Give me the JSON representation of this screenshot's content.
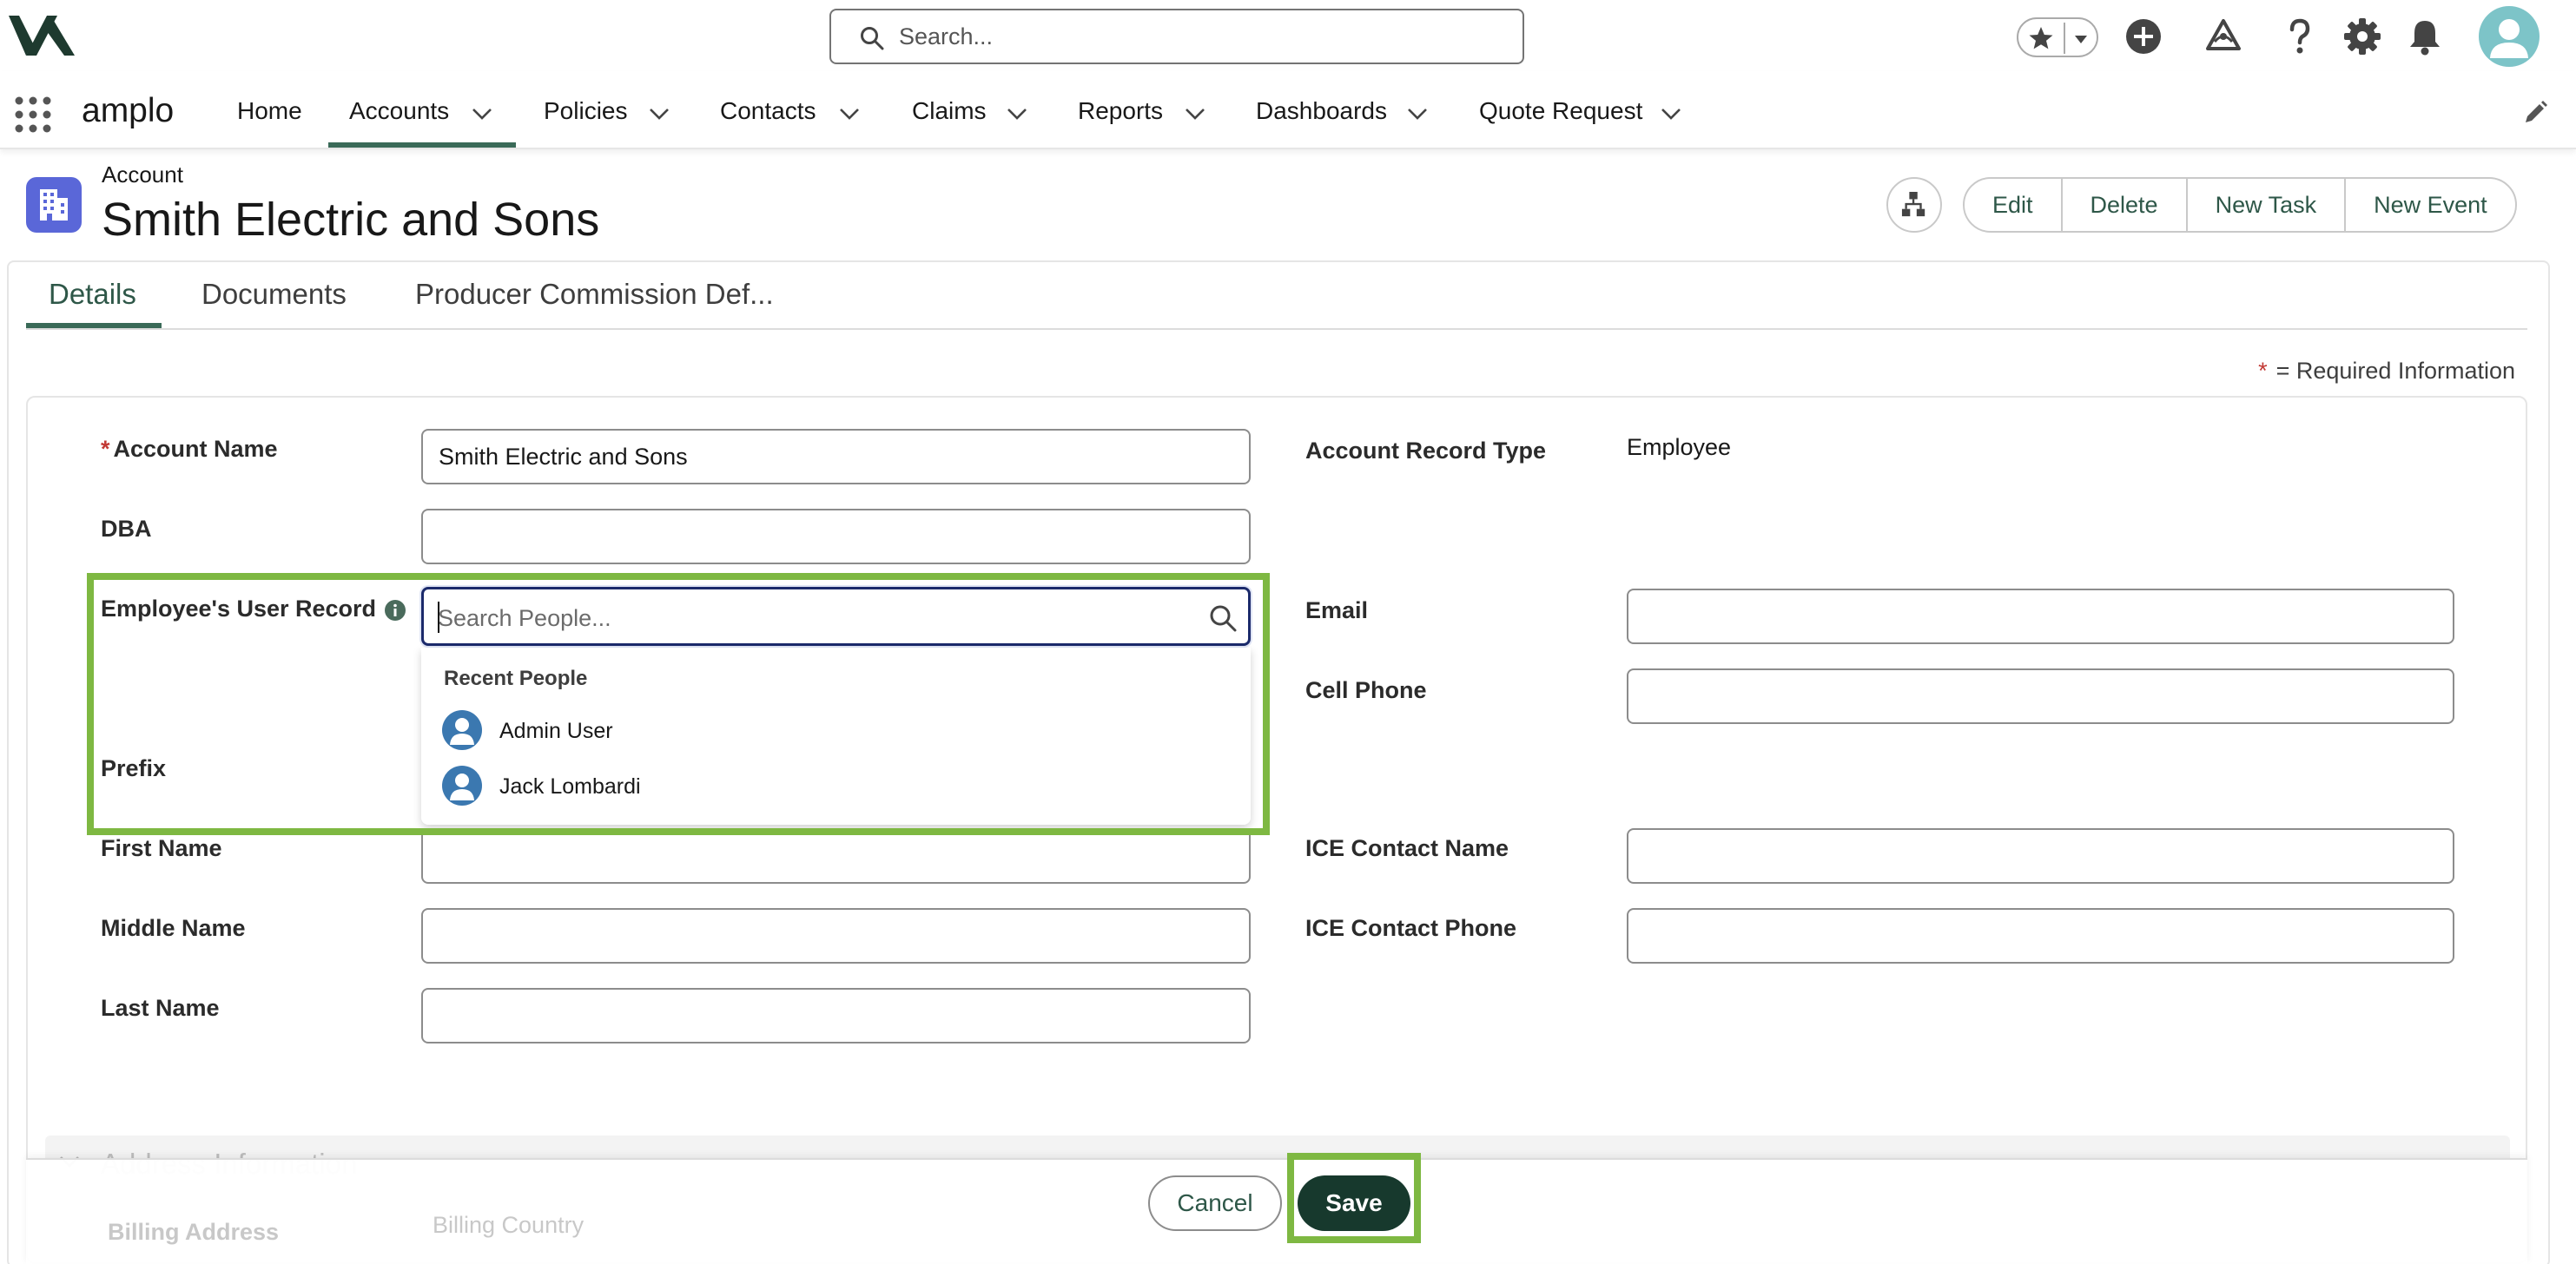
{
  "header": {
    "search_placeholder": "Search...",
    "icons": [
      "favorites-star-icon",
      "favorites-dropdown-icon",
      "global-add-icon",
      "trailhead-icon",
      "help-icon",
      "settings-gear-icon",
      "notifications-bell-icon",
      "user-avatar"
    ]
  },
  "nav": {
    "app_name": "amplo",
    "items": [
      {
        "label": "Home",
        "has_menu": false
      },
      {
        "label": "Accounts",
        "has_menu": true,
        "active": true
      },
      {
        "label": "Policies",
        "has_menu": true
      },
      {
        "label": "Contacts",
        "has_menu": true
      },
      {
        "label": "Claims",
        "has_menu": true
      },
      {
        "label": "Reports",
        "has_menu": true
      },
      {
        "label": "Dashboards",
        "has_menu": true
      },
      {
        "label": "Quote Request",
        "has_menu": true
      }
    ]
  },
  "record": {
    "object_label": "Account",
    "title": "Smith Electric and Sons",
    "actions": [
      "Edit",
      "Delete",
      "New Task",
      "New Event"
    ]
  },
  "tabs": [
    {
      "label": "Details",
      "active": true
    },
    {
      "label": "Documents"
    },
    {
      "label": "Producer Commission Def..."
    }
  ],
  "form": {
    "required_marker": "*",
    "required_info": "= Required Information",
    "left_fields": {
      "account_name": {
        "label": "Account Name",
        "value": "Smith Electric and Sons",
        "required": true
      },
      "dba": {
        "label": "DBA",
        "value": ""
      },
      "employee_user_record": {
        "label": "Employee's User Record",
        "placeholder": "Search People..."
      },
      "prefix": {
        "label": "Prefix"
      },
      "first_name": {
        "label": "First Name",
        "value": ""
      },
      "middle_name": {
        "label": "Middle Name",
        "value": ""
      },
      "last_name": {
        "label": "Last Name",
        "value": ""
      }
    },
    "right_fields": {
      "account_record_type": {
        "label": "Account Record Type",
        "value": "Employee"
      },
      "email": {
        "label": "Email",
        "value": ""
      },
      "cell_phone": {
        "label": "Cell Phone",
        "value": ""
      },
      "ice_contact_name": {
        "label": "ICE Contact Name",
        "value": ""
      },
      "ice_contact_phone": {
        "label": "ICE Contact Phone",
        "value": ""
      }
    },
    "lookup_dropdown": {
      "header": "Recent People",
      "items": [
        "Admin User",
        "Jack Lombardi"
      ]
    }
  },
  "address_section": {
    "title": "Address Information",
    "billing_address_label": "Billing Address",
    "billing_country_label": "Billing Country"
  },
  "footer": {
    "cancel_label": "Cancel",
    "save_label": "Save"
  },
  "colors": {
    "accent": "#2e5748",
    "save_button": "#17392d",
    "highlight": "#7eb842",
    "object_icon": "#5a67d8",
    "lookup_focus": "#1b2a6b",
    "required": "#c23934"
  }
}
